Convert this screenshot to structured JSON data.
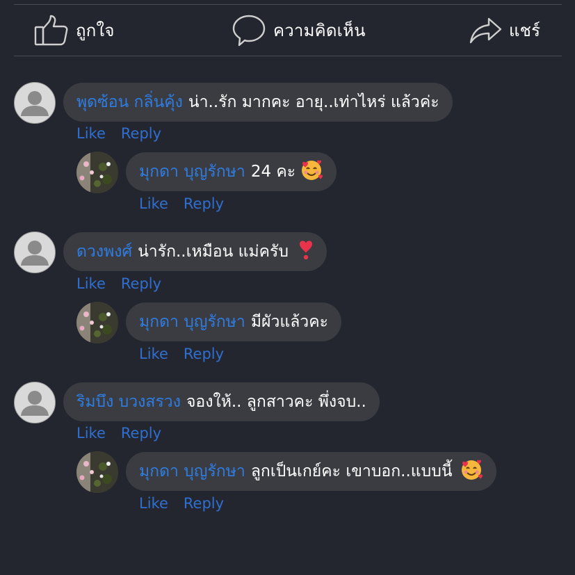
{
  "actions": {
    "like_label": "ถูกใจ",
    "comment_label": "ความคิดเห็น",
    "share_label": "แชร์"
  },
  "colors": {
    "background": "#24262f",
    "bubble": "#3a3c42",
    "name": "#2f7de1",
    "link": "#2f6fd0",
    "divider": "#4a4c55"
  },
  "comments": [
    {
      "author": "พุดซ้อน กลิ่นคุ้ง",
      "text": "น่า..รัก มากคะ อายุ..เท่าไหร่ แล้วค่ะ",
      "like": "Like",
      "reply": "Reply",
      "avatar": "default-avatar-icon",
      "reply_comment": {
        "author": "มุกดา บุญรักษา",
        "text": "24 คะ",
        "emoji": "smiling-face-with-hearts-icon",
        "like": "Like",
        "reply": "Reply",
        "avatar": "flower-photo-avatar"
      }
    },
    {
      "author": "ดวงพงศ์",
      "text": "น่ารัก..เหมือน แม่ครับ",
      "emoji": "heart-exclamation-icon",
      "like": "Like",
      "reply": "Reply",
      "avatar": "default-avatar-icon",
      "reply_comment": {
        "author": "มุกดา บุญรักษา",
        "text": "มีผัวแล้วคะ",
        "like": "Like",
        "reply": "Reply",
        "avatar": "flower-photo-avatar"
      }
    },
    {
      "author": "ริมบึง บวงสรวง",
      "text": "จองให้.. ลูกสาวคะ พึ่งจบ..",
      "like": "Like",
      "reply": "Reply",
      "avatar": "default-avatar-icon",
      "reply_comment": {
        "author": "มุกดา บุญรักษา",
        "text": "ลูกเป็นเกย์คะ เขาบอก..แบบนี้",
        "emoji": "smiling-face-with-hearts-icon",
        "like": "Like",
        "reply": "Reply",
        "avatar": "flower-photo-avatar"
      }
    }
  ]
}
